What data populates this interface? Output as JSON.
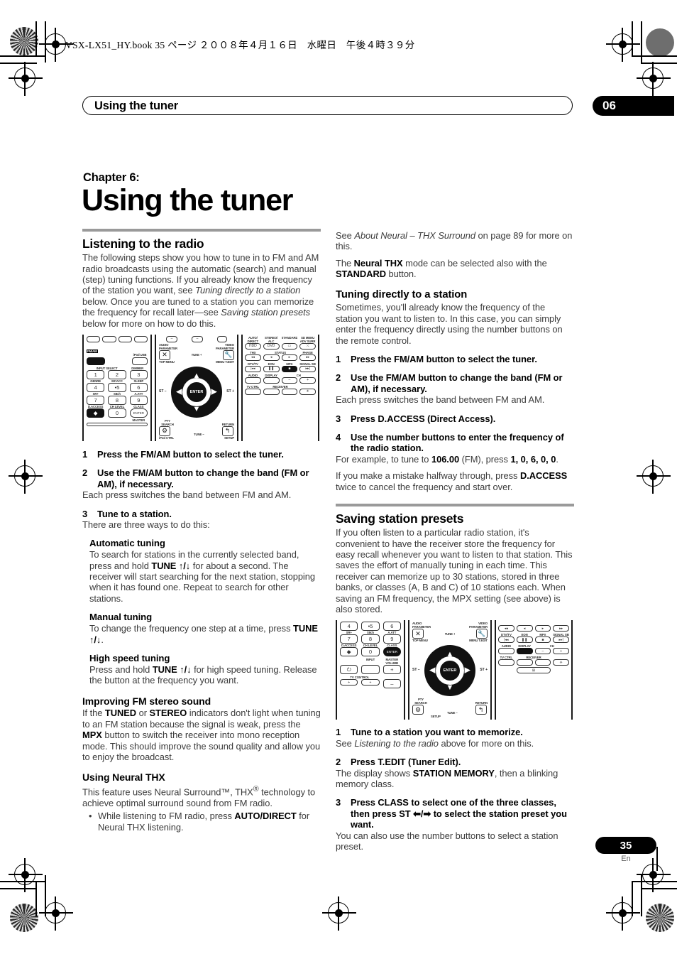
{
  "print_slug": "VSX-LX51_HY.book   35 ページ   ２００８年４月１６日　水曜日　午後４時３９分",
  "header": {
    "running_head": "Using the tuner",
    "chapter_number": "06"
  },
  "title_block": {
    "chapter_label": "Chapter 6:",
    "chapter_title": "Using the tuner"
  },
  "left_column": {
    "section1": {
      "heading": "Listening to the radio",
      "intro_1": "The following steps show you how to tune in to FM and AM radio broadcasts using the automatic (search) and manual (step) tuning functions. If you already know the frequency of the station you want, see ",
      "intro_1_ital_a": "Tuning directly to a station",
      "intro_1_mid": " below. Once you are tuned to a station you can memorize the frequency for recall later—see ",
      "intro_1_ital_b": "Saving station presets",
      "intro_1_end": " below for more on how to do this."
    },
    "steps": [
      {
        "num": "1",
        "text": "Press the FM/AM button to select the tuner.",
        "body": ""
      },
      {
        "num": "2",
        "text": "Use the FM/AM button to change the band (FM or AM), if necessary.",
        "body": "Each press switches the band between FM and AM."
      },
      {
        "num": "3",
        "text": "Tune to a station.",
        "body": "There are three ways to do this:"
      }
    ],
    "tuning_modes": [
      {
        "heading": "Automatic tuning",
        "body_a": "To search for stations in the currently selected band, press and hold ",
        "bold": "TUNE ↑/↓",
        "body_b": " for about a second. The receiver will start searching for the next station, stopping when it has found one. Repeat to search for other stations."
      },
      {
        "heading": "Manual tuning",
        "body_a": "To change the frequency one step at a time, press ",
        "bold": "TUNE ↑/↓",
        "body_b": "."
      },
      {
        "heading": "High speed tuning",
        "body_a": "Press and hold ",
        "bold": "TUNE ↑/↓",
        "body_b": " for high speed tuning. Release the button at the frequency you want."
      }
    ],
    "fm_stereo": {
      "heading": "Improving FM stereo sound",
      "p_a": "If the ",
      "b1": "TUNED",
      "p_b": " or ",
      "b2": "STEREO",
      "p_c": " indicators don't light when tuning to an FM station because the signal is weak, press the ",
      "b3": "MPX",
      "p_d": " button to switch the receiver into mono reception mode. This should improve the sound quality and allow you to enjoy the broadcast."
    },
    "neural_thx": {
      "heading": "Using Neural THX",
      "p_a": "This feature uses Neural Surround™, THX",
      "sup": "®",
      "p_b": " technology to achieve optimal surround sound from FM radio.",
      "bullet_a": "While listening to FM radio, press ",
      "bullet_bold": "AUTO/DIRECT",
      "bullet_b": " for Neural THX listening."
    }
  },
  "right_column": {
    "lead": {
      "see_a": "See ",
      "see_ital": "About Neural – THX Surround",
      "see_b": " on page 89 for more on this.",
      "mode_a": "The ",
      "mode_b1": "Neural THX",
      "mode_b": " mode can be selected also with the ",
      "mode_b2": "STANDARD",
      "mode_c": " button."
    },
    "section2": {
      "heading": "Tuning directly to a station",
      "intro": "Sometimes, you'll already know the frequency of the station you want to listen to. In this case, you can simply enter the frequency directly using the number buttons on the remote control."
    },
    "steps2": [
      {
        "num": "1",
        "text": "Press the FM/AM button to select the tuner.",
        "body": ""
      },
      {
        "num": "2",
        "text": "Use the FM/AM button to change the band (FM or AM), if necessary.",
        "body": "Each press switches the band between FM and AM."
      },
      {
        "num": "3",
        "text": "Press D.ACCESS (Direct Access).",
        "body": ""
      },
      {
        "num": "4",
        "text": "Use the number buttons to enter the frequency of the radio station.",
        "body": ""
      }
    ],
    "example": {
      "a": "For example, to tune to ",
      "freq": "106.00",
      "b": " (FM), press ",
      "digits": "1, 0, 6, 0, 0",
      "c": "."
    },
    "mistake": {
      "a": "If you make a mistake halfway through, press ",
      "bold": "D.ACCESS",
      "b": " twice to cancel the frequency and start over."
    },
    "section3": {
      "heading": "Saving station presets",
      "intro": "If you often listen to a particular radio station, it's convenient to have the receiver store the frequency for easy recall whenever you want to listen to that station. This saves the effort of manually tuning in each time. This receiver can memorize up to 30 stations, stored in three banks, or classes (A, B and C) of 10 stations each. When saving an FM frequency, the MPX setting (see above) is also stored."
    },
    "steps3": [
      {
        "num": "1",
        "text": "Tune to a station you want to memorize.",
        "body_a": "See ",
        "body_ital": "Listening to the radio",
        "body_b": " above for more on this."
      },
      {
        "num": "2",
        "text": "Press T.EDIT (Tuner Edit).",
        "body_a": "The display shows ",
        "body_bold": "STATION MEMORY",
        "body_b": ", then a blinking memory class."
      },
      {
        "num": "3",
        "text": "Press CLASS to select one of the three classes, then press ST ⬅/➡ to select the station preset you want.",
        "body_a": "You can also use the number buttons to select a station preset.",
        "body_ital": "",
        "body_b": ""
      }
    ]
  },
  "remote_top": {
    "panel1": {
      "fm_am": "FM/AM",
      "ipod_usb": "iPod USB",
      "input_select": "INPUT SELECT",
      "dimmer": "DIMMER",
      "keys": [
        "1",
        "2",
        "3",
        "4",
        "•5",
        "6",
        "7",
        "8",
        "9",
        "",
        "0",
        "ENTER"
      ],
      "labels_row1": [
        "GENRE",
        "MCACC",
        "SLEEP"
      ],
      "labels_row2": [
        "SR+",
        "S8ch",
        "A.ATT"
      ],
      "labels_row3": [
        "D.ACCESS",
        "CH LEVEL",
        "CLASS"
      ],
      "master": "MASTER"
    },
    "panel2": {
      "audio_parameter": "AUDIO PARAMETER",
      "video_parameter": "VIDEO PARAMETER",
      "exit": "EXIT",
      "tools": "TOOLS",
      "tune_plus": "TUNE +",
      "tune_minus": "TUNE –",
      "top_menu": "TOP MENU",
      "menu_tedit": "MENU T.EDIT",
      "st_minus": "ST –",
      "st_plus": "ST +",
      "enter": "ENTER",
      "pty_search": "PTY SEARCH",
      "setup": "SETUP",
      "return": "RETURN",
      "ipod_ctrl": "iPod CTRL"
    },
    "panel3": {
      "auto_direct": "AUTO/ DIRECT",
      "stereo_alc": "STEREO/ ALC",
      "standard": "STANDARD",
      "sd_menu": "SD MENU ADV SURR",
      "hdd": "HDD",
      "dvd": "DVD",
      "thx": "THX",
      "status": "STATUS",
      "phase": "PHASE",
      "dtv_tv": "DTV/TV",
      "eon": "EON",
      "mpx": "MPX",
      "signal_sel": "SIGNAL SEL",
      "audio": "AUDIO",
      "display": "DISPLAY",
      "ch": "CH",
      "tv_ctrl": "TV CTRL",
      "receiver": "RECEIVER"
    }
  },
  "remote_bottom": {
    "panel1": {
      "keys": [
        "4",
        "•5",
        "6",
        "7",
        "8",
        "9",
        "",
        "0",
        "ENTER"
      ],
      "labels_row1": [
        "SR+",
        "S8ch",
        "A.ATT"
      ],
      "labels_row2": [
        "D.ACCESS",
        "CH LEVEL",
        "CLASS"
      ],
      "input": "INPUT",
      "master_volume": "MASTER VOLUME",
      "tv_control": "TV CONTROL",
      "plus": "+",
      "minus": "–"
    },
    "panel2": {
      "audio_parameter": "AUDIO PARAMETER",
      "video_parameter": "VIDEO PARAMETER",
      "exit": "EXIT",
      "tools": "TOOLS",
      "tune_plus": "TUNE +",
      "tune_minus": "TUNE –",
      "top_menu": "TOP MENU",
      "menu_tedit": "MENU T.EDIT",
      "st_minus": "ST –",
      "st_plus": "ST +",
      "enter": "ENTER",
      "pty_search": "PTY SEARCH",
      "setup": "SETUP",
      "return": "RETURN"
    },
    "panel3": {
      "dtv_tv": "DTV/TV",
      "eon": "EON",
      "mpx": "MPX",
      "signal_sel": "SIGNAL SEL",
      "audio": "AUDIO",
      "display": "DISPLAY",
      "ch": "CH",
      "tv_ctrl": "TV CTRL",
      "receiver": "RECEIVER"
    }
  },
  "footer": {
    "page_number": "35",
    "language": "En"
  },
  "colors": {
    "rule": "#9a9a9a",
    "body_text": "#3b3b3b",
    "accent_black": "#000000"
  }
}
